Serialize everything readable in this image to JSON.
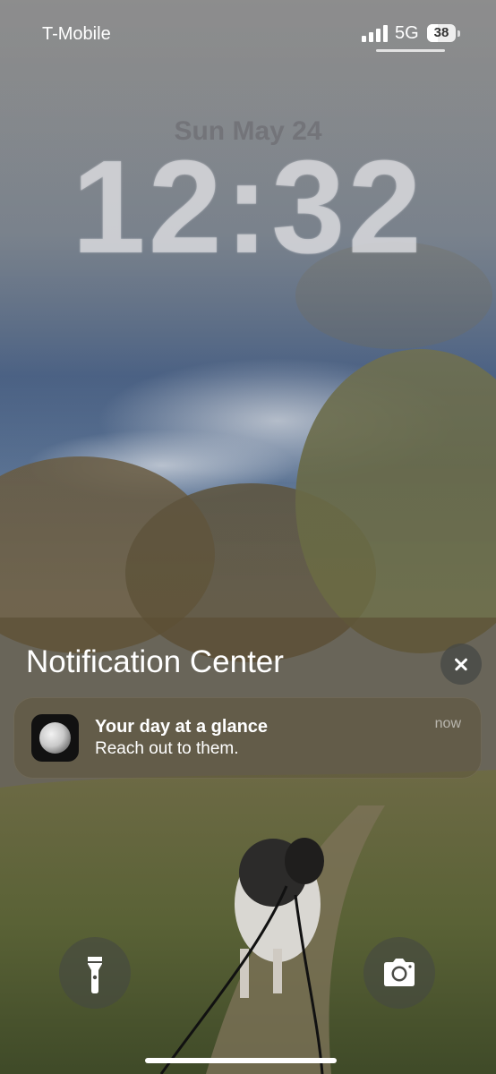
{
  "status_bar": {
    "carrier": "T-Mobile",
    "network": "5G",
    "battery_level": 38,
    "battery_text": "38"
  },
  "lock_screen": {
    "date": "Sun May 24",
    "time": "12:32"
  },
  "notification_center": {
    "title": "Notification Center",
    "close_icon": "close-icon",
    "notifications": [
      {
        "app_icon": "moon-icon",
        "title": "Your day at a glance",
        "body": "Reach out to them.",
        "time": "now"
      }
    ]
  },
  "quick_actions": {
    "left_icon": "flashlight-icon",
    "right_icon": "camera-icon"
  },
  "colors": {
    "text": "#ffffff",
    "card_background": "#5f553c"
  }
}
